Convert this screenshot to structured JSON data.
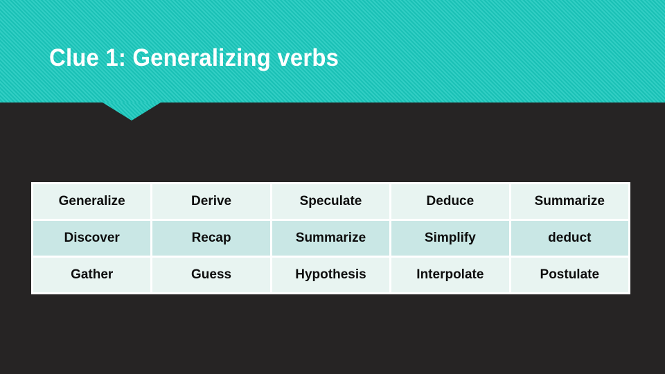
{
  "slide": {
    "title": "Clue 1: Generalizing verbs",
    "background_color": "#262424",
    "banner_color": "#1bc9bd",
    "title_color": "#ffffff"
  },
  "table": {
    "row_light_color": "#e8f4f1",
    "row_dark_color": "#c9e7e5",
    "text_color": "#0d0d0d",
    "rows": [
      {
        "style": "light",
        "cells": [
          "Generalize",
          "Derive",
          "Speculate",
          "Deduce",
          "Summarize"
        ]
      },
      {
        "style": "dark",
        "cells": [
          "Discover",
          "Recap",
          "Summarize",
          "Simplify",
          "deduct"
        ]
      },
      {
        "style": "light",
        "cells": [
          "Gather",
          "Guess",
          "Hypothesis",
          "Interpolate",
          "Postulate"
        ]
      }
    ]
  }
}
